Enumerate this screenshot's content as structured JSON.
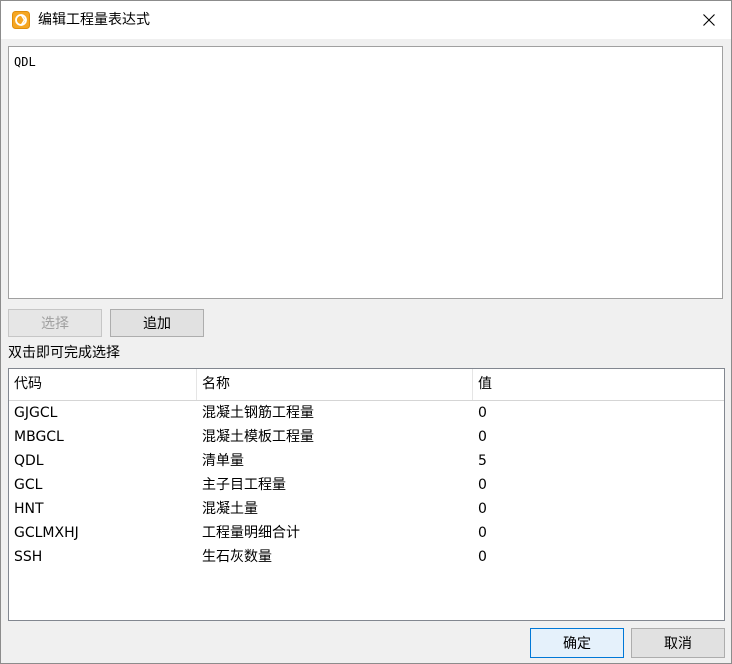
{
  "window": {
    "title": "编辑工程量表达式",
    "icon": "app-logo-icon",
    "close_icon": "close-icon"
  },
  "expression": {
    "value": "QDL"
  },
  "buttons": {
    "select_label": "选择",
    "add_label": "追加",
    "ok_label": "确定",
    "cancel_label": "取消"
  },
  "hint_text": "双击即可完成选择",
  "table": {
    "columns": [
      "代码",
      "名称",
      "值"
    ],
    "rows": [
      {
        "code": "GJGCL",
        "name": "混凝土钢筋工程量",
        "value": "0"
      },
      {
        "code": "MBGCL",
        "name": "混凝土模板工程量",
        "value": "0"
      },
      {
        "code": "QDL",
        "name": "清单量",
        "value": "5"
      },
      {
        "code": "GCL",
        "name": "主子目工程量",
        "value": "0"
      },
      {
        "code": "HNT",
        "name": "混凝土量",
        "value": "0"
      },
      {
        "code": "GCLMXHJ",
        "name": "工程量明细合计",
        "value": "0"
      },
      {
        "code": "SSH",
        "name": "生石灰数量",
        "value": "0"
      }
    ]
  },
  "colors": {
    "accent": "#0078d7",
    "icon_orange": "#f5a623"
  }
}
